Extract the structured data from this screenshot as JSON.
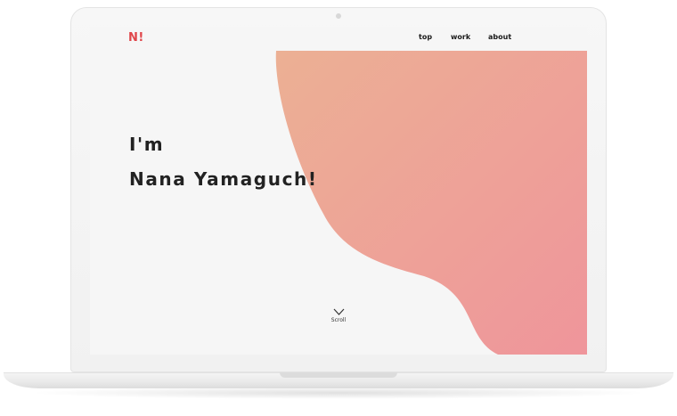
{
  "site": {
    "logo": "N!",
    "nav": [
      {
        "label": "top"
      },
      {
        "label": "work"
      },
      {
        "label": "about"
      }
    ],
    "hero": {
      "line1": "I'm",
      "line2": "Nana Yamaguch!"
    },
    "scroll": {
      "label": "Scroll"
    }
  },
  "colors": {
    "logo": "#e0454a",
    "blob_start": "#ecb094",
    "blob_end": "#ef959b",
    "screen_bg": "#f6f6f6"
  },
  "icons": {
    "scroll": "chevron-down-icon"
  }
}
